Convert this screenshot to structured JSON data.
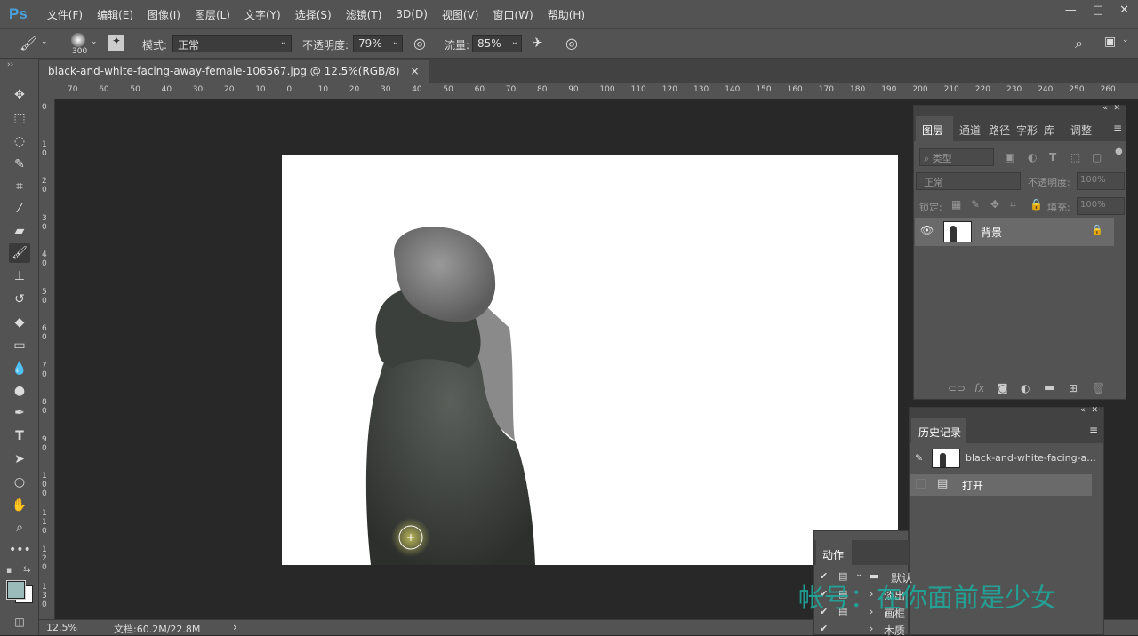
{
  "menubar": {
    "logo": "Ps",
    "items": [
      "文件(F)",
      "编辑(E)",
      "图像(I)",
      "图层(L)",
      "文字(Y)",
      "选择(S)",
      "滤镜(T)",
      "3D(D)",
      "视图(V)",
      "窗口(W)",
      "帮助(H)"
    ]
  },
  "options": {
    "brush_size": "300",
    "mode_label": "模式:",
    "mode_value": "正常",
    "opacity_label": "不透明度:",
    "opacity_value": "79%",
    "flow_label": "流量:",
    "flow_value": "85%"
  },
  "document": {
    "tab_title": "black-and-white-facing-away-female-106567.jpg @ 12.5%(RGB/8)",
    "close": "×"
  },
  "ruler_h": [
    "70",
    "60",
    "50",
    "40",
    "30",
    "20",
    "10",
    "0",
    "10",
    "20",
    "30",
    "40",
    "50",
    "60",
    "70",
    "80",
    "90",
    "100",
    "110",
    "120",
    "130",
    "140",
    "150",
    "160",
    "170",
    "180",
    "190",
    "200",
    "210",
    "220",
    "230",
    "240",
    "250",
    "260"
  ],
  "ruler_v": [
    "0",
    "1 0",
    "2 0",
    "3 0",
    "4 0",
    "5 0",
    "6 0",
    "7 0",
    "8 0",
    "9 0",
    "1 0 0",
    "1 1 0",
    "1 2 0",
    "1 3 0"
  ],
  "status": {
    "zoom": "12.5%",
    "doc_info": "文档:60.2M/22.8M",
    "arrow": "›"
  },
  "layers_panel": {
    "tabs": [
      "图层",
      "通道",
      "路径",
      "字形",
      "库",
      "调整"
    ],
    "filter_placeholder": "类型",
    "blend_mode": "正常",
    "opacity_label": "不透明度:",
    "opacity_value": "100%",
    "lock_label": "锁定:",
    "fill_label": "填充:",
    "fill_value": "100%",
    "layer_name": "背景"
  },
  "history_panel": {
    "title": "历史记录",
    "snapshot": "black-and-white-facing-a...",
    "step": "打开"
  },
  "actions_panel": {
    "title": "动作",
    "rows": [
      "默认",
      "淡出",
      "画框",
      "木质"
    ]
  },
  "watermark": "帐号：在你面前是少女",
  "colors": {
    "foreground": "#9bbbbb",
    "background": "#ffffff",
    "accent": "#4aa3df"
  }
}
